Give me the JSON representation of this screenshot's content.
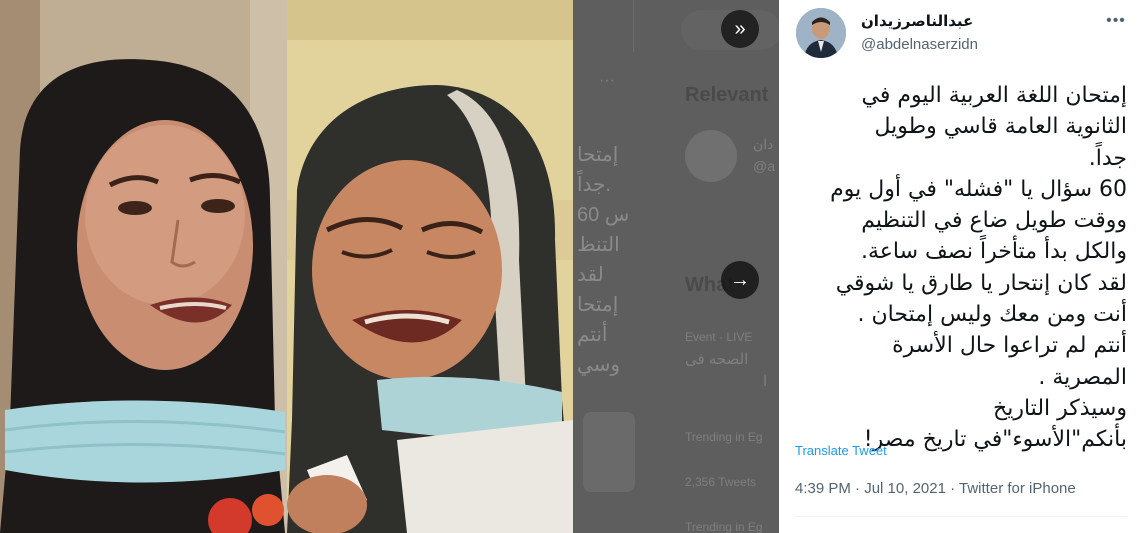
{
  "tweet": {
    "author_name": "عبدالناصرزيدان",
    "author_handle": "@abdelnaserzidn",
    "lines": [
      "إمتحان اللغة العربية اليوم في",
      "الثانوية العامة قاسي وطويل",
      "جداً.",
      "60 سؤال يا \"فشله\" في أول يوم",
      "ووقت طويل ضاع في التنظيم",
      "والكل بدأ متأخراً نصف ساعة.",
      "لقد كان إنتحار يا طارق يا شوقي",
      "أنت ومن معك وليس إمتحان .",
      "أنتم لم تراعوا حال الأسرة",
      "المصرية .",
      "وسيذكر التاريخ",
      "بأنكم\"الأسوء\"في تاريخ مصر!"
    ],
    "translate_label": "Translate Tweet",
    "time": "4:39 PM",
    "separator1": " · ",
    "date": "Jul 10, 2021",
    "separator2": " · ",
    "source": "Twitter for iPhone"
  },
  "controls": {
    "expand_icon": "chevrons-right-icon",
    "expand_glyph": "»",
    "next_icon": "arrow-right-icon",
    "next_glyph": "→",
    "more_icon": "more-horizontal-icon",
    "more_glyph": "•••"
  },
  "background_page": {
    "relevant_heading": "Relevant",
    "whats_heading": "What",
    "trending_1": "Trending in Eg",
    "tweets_count": "2,356 Tweets",
    "trending_2": "Trending in Eg",
    "event_live": "Event · LIVE",
    "partial_name": "دان",
    "partial_handle": "@a",
    "partial_lines": [
      "إمتحا",
      "جداً.",
      "60 س",
      "التنظ",
      "لقد",
      "إمتحا",
      "أنتم",
      "وسي"
    ],
    "partial_event": "الصحه فى",
    "partial_event2": "ا"
  },
  "colors": {
    "link": "#1d9bf0",
    "text_primary": "#0f1419",
    "text_secondary": "#536471",
    "overlay_button": "#0f0f0f"
  }
}
